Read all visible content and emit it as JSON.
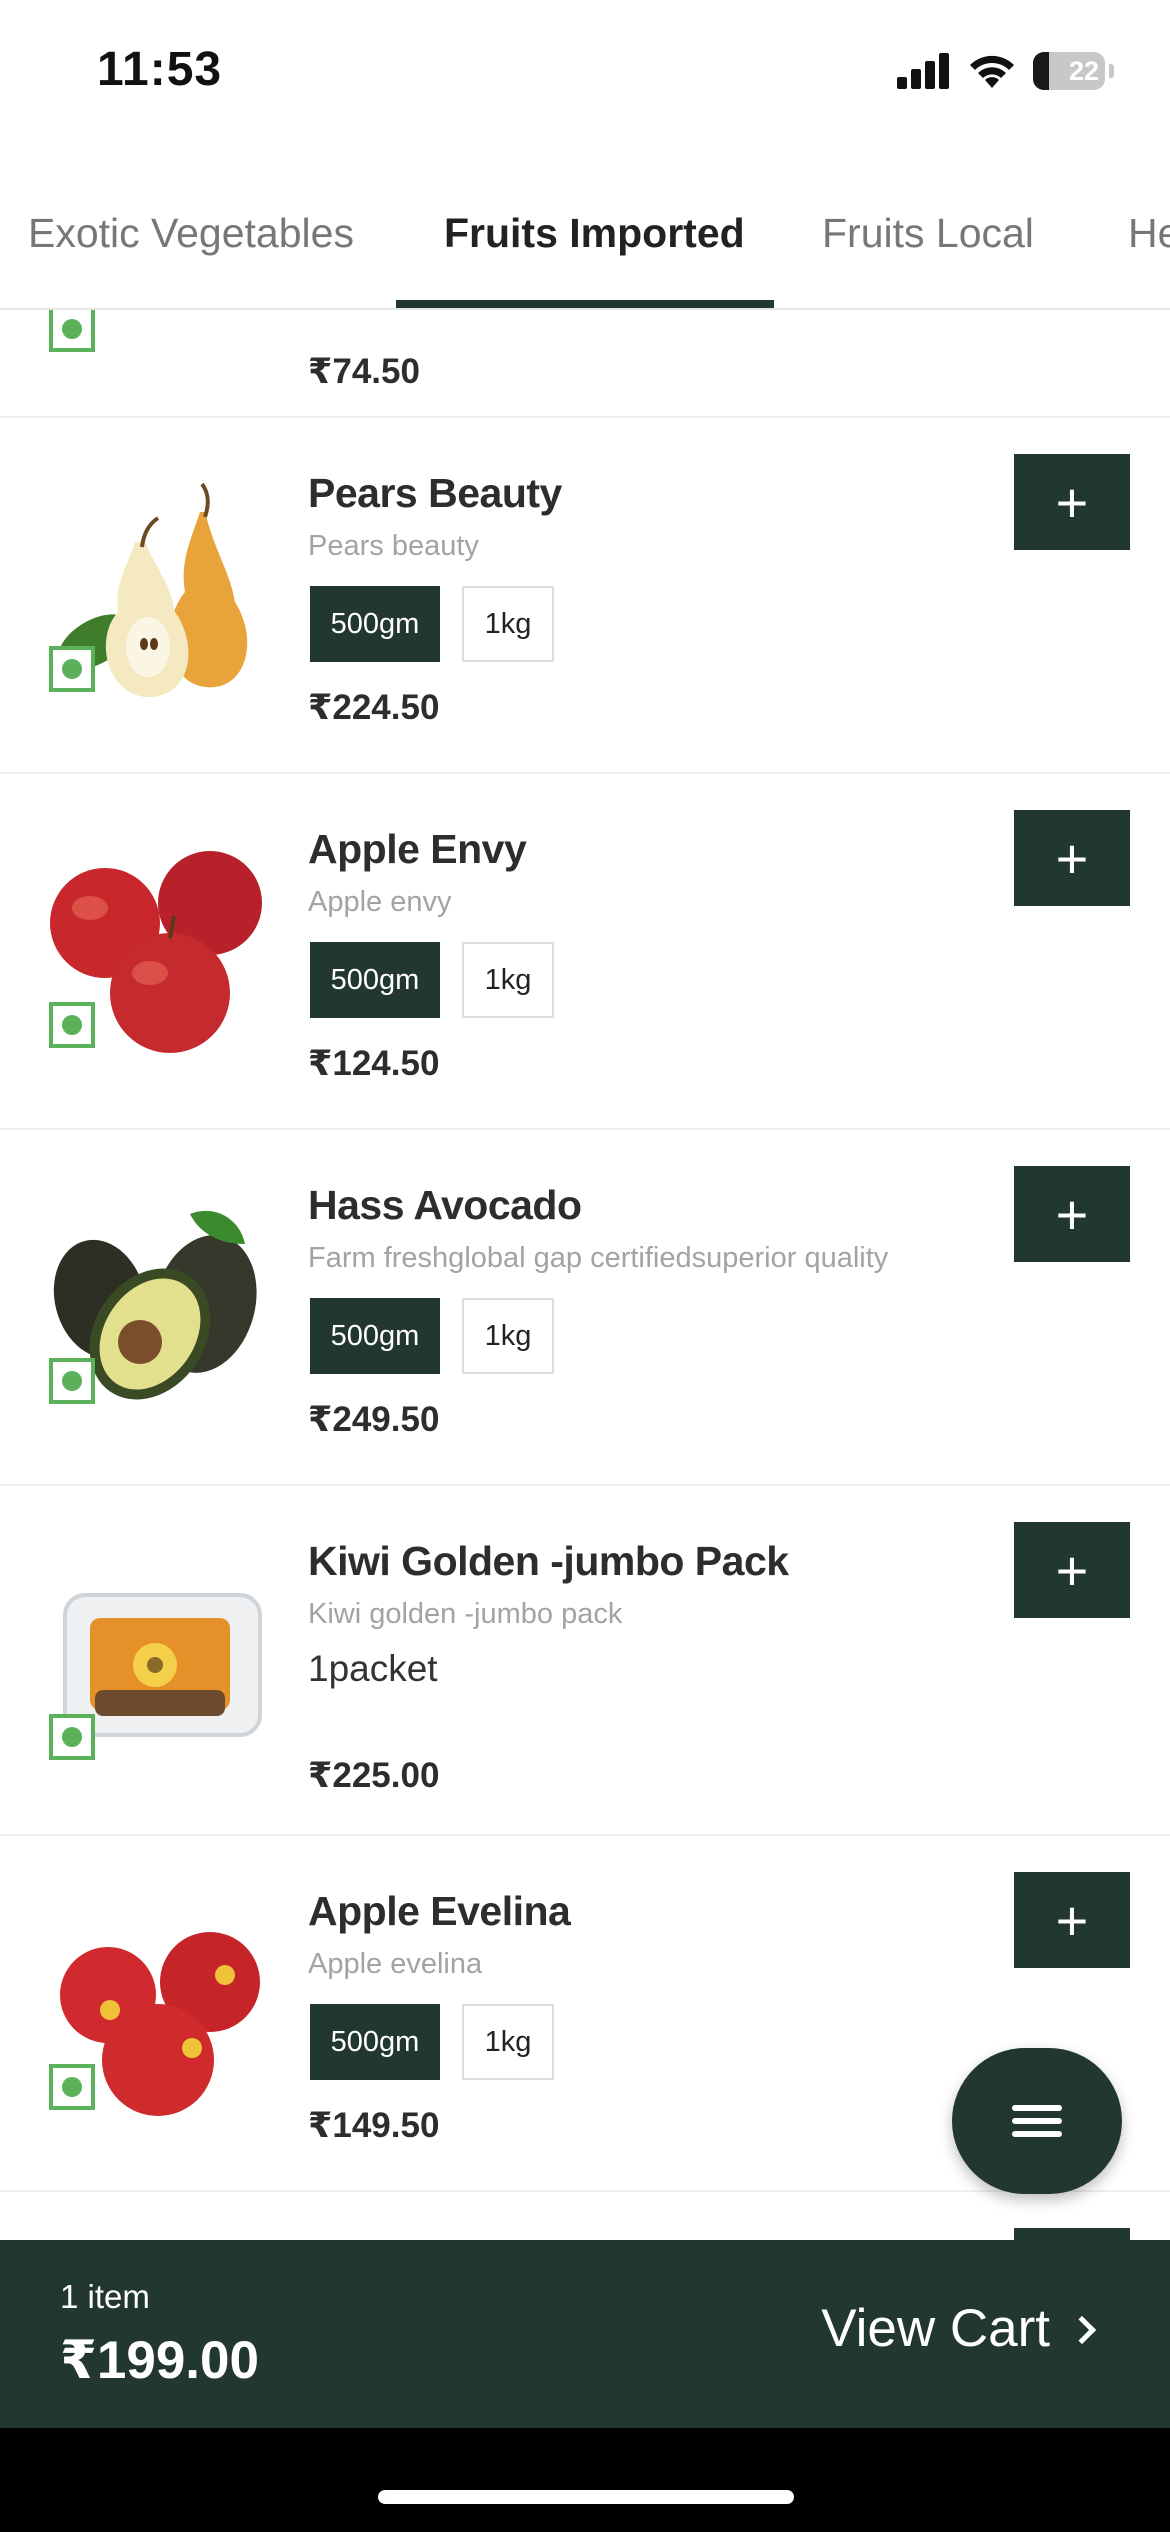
{
  "status_bar": {
    "time": "11:53",
    "battery": "22",
    "battery_level": 0.22
  },
  "tabs": [
    {
      "label": "Exotic Vegetables",
      "active": false
    },
    {
      "label": "Fruits Imported",
      "active": true
    },
    {
      "label": "Fruits Local",
      "active": false
    },
    {
      "label": "He",
      "active": false
    }
  ],
  "products": [
    {
      "name": "",
      "description": "",
      "price": "₹74.50"
    },
    {
      "name": "Pears Beauty",
      "description": "Pears beauty",
      "options": [
        "500gm",
        "1kg"
      ],
      "selected_option": "500gm",
      "price": "₹224.50",
      "add_label": "+"
    },
    {
      "name": "Apple Envy",
      "description": "Apple envy",
      "options": [
        "500gm",
        "1kg"
      ],
      "selected_option": "500gm",
      "price": "₹124.50",
      "add_label": "+"
    },
    {
      "name": "Hass Avocado",
      "description": "Farm freshglobal gap certifiedsuperior quality",
      "options": [
        "500gm",
        "1kg"
      ],
      "selected_option": "500gm",
      "price": "₹249.50",
      "add_label": "+"
    },
    {
      "name": "Kiwi Golden -jumbo Pack",
      "description": "Kiwi golden -jumbo pack",
      "pack": "1packet",
      "price": "₹225.00",
      "add_label": "+"
    },
    {
      "name": "Apple Evelina",
      "description": "Apple evelina",
      "options": [
        "500gm",
        "1kg"
      ],
      "selected_option": "500gm",
      "price": "₹149.50",
      "add_label": "+"
    }
  ],
  "cart": {
    "count": "1 item",
    "total": "₹199.00",
    "cta": "View Cart"
  },
  "colors": {
    "primary": "#22372d",
    "veg_mark": "#5bb15a",
    "muted_text": "#a3a3a3"
  }
}
